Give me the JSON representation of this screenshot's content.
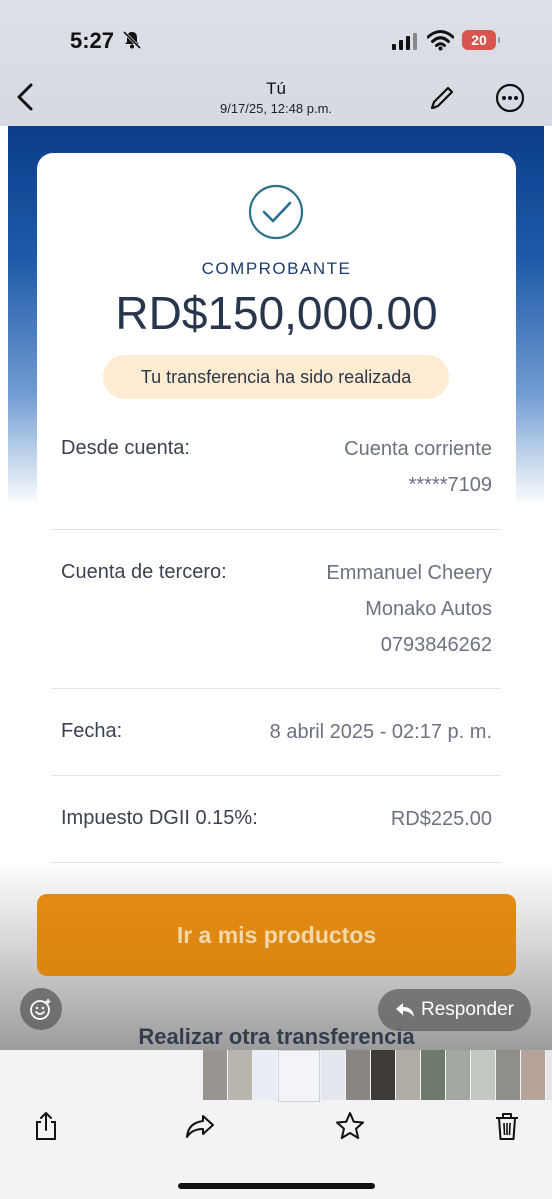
{
  "status_bar": {
    "time": "5:27",
    "battery": "20"
  },
  "nav": {
    "title": "Tú",
    "subtitle": "9/17/25, 12:48 p.m."
  },
  "receipt": {
    "label": "COMPROBANTE",
    "amount": "RD$150,000.00",
    "status_message": "Tu transferencia ha sido realizada",
    "rows": [
      {
        "label": "Desde cuenta:",
        "values": [
          "Cuenta corriente",
          "*****7109"
        ]
      },
      {
        "label": "Cuenta de tercero:",
        "values": [
          "Emmanuel Cheery",
          "Monako Autos",
          "0793846262"
        ]
      },
      {
        "label": "Fecha:",
        "values": [
          "8 abril 2025 - 02:17 p. m."
        ]
      },
      {
        "label": "Impuesto DGII 0.15%:",
        "values": [
          "RD$225.00"
        ]
      }
    ],
    "primary_button": "Ir a mis productos",
    "secondary_button": "Realizar otra transferencia"
  },
  "overlay": {
    "reply_label": "Responder"
  },
  "colors": {
    "brand_blue": "#0a3d8c",
    "cta_orange": "#e38a13",
    "pill_bg": "#fdecd2",
    "check_teal": "#2a6f8f"
  }
}
